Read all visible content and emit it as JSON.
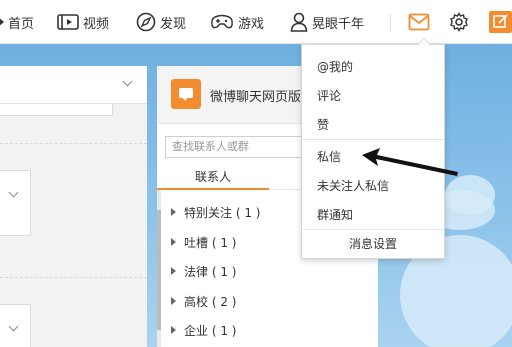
{
  "nav": {
    "home_label": "首页",
    "video_label": "视频",
    "discover_label": "发现",
    "game_label": "游戏",
    "username": "晃眼千年"
  },
  "chat": {
    "title": "微博聊天网页版",
    "search_placeholder": "查找联系人或群",
    "tab_contacts": "联系人",
    "groups": [
      {
        "name": "特别关注",
        "count_text": "( 1 )"
      },
      {
        "name": "吐槽",
        "count_text": "( 1 )"
      },
      {
        "name": "法律",
        "count_text": "( 1 )"
      },
      {
        "name": "高校",
        "count_text": "( 2 )"
      },
      {
        "name": "企业",
        "count_text": "( 1 )"
      }
    ]
  },
  "dropdown": {
    "items": [
      "@我的",
      "评论",
      "赞",
      "私信",
      "未关注人私信",
      "群通知"
    ],
    "footer": "消息设置"
  },
  "colors": {
    "accent_orange": "#f28c2f",
    "sky_blue": "#8cc3ea"
  },
  "icons": [
    "home-icon",
    "video-icon",
    "discover-icon",
    "game-icon",
    "user-icon",
    "mail-icon",
    "gear-icon",
    "edit-icon",
    "chevron-down-icon",
    "arrow-annotation"
  ]
}
